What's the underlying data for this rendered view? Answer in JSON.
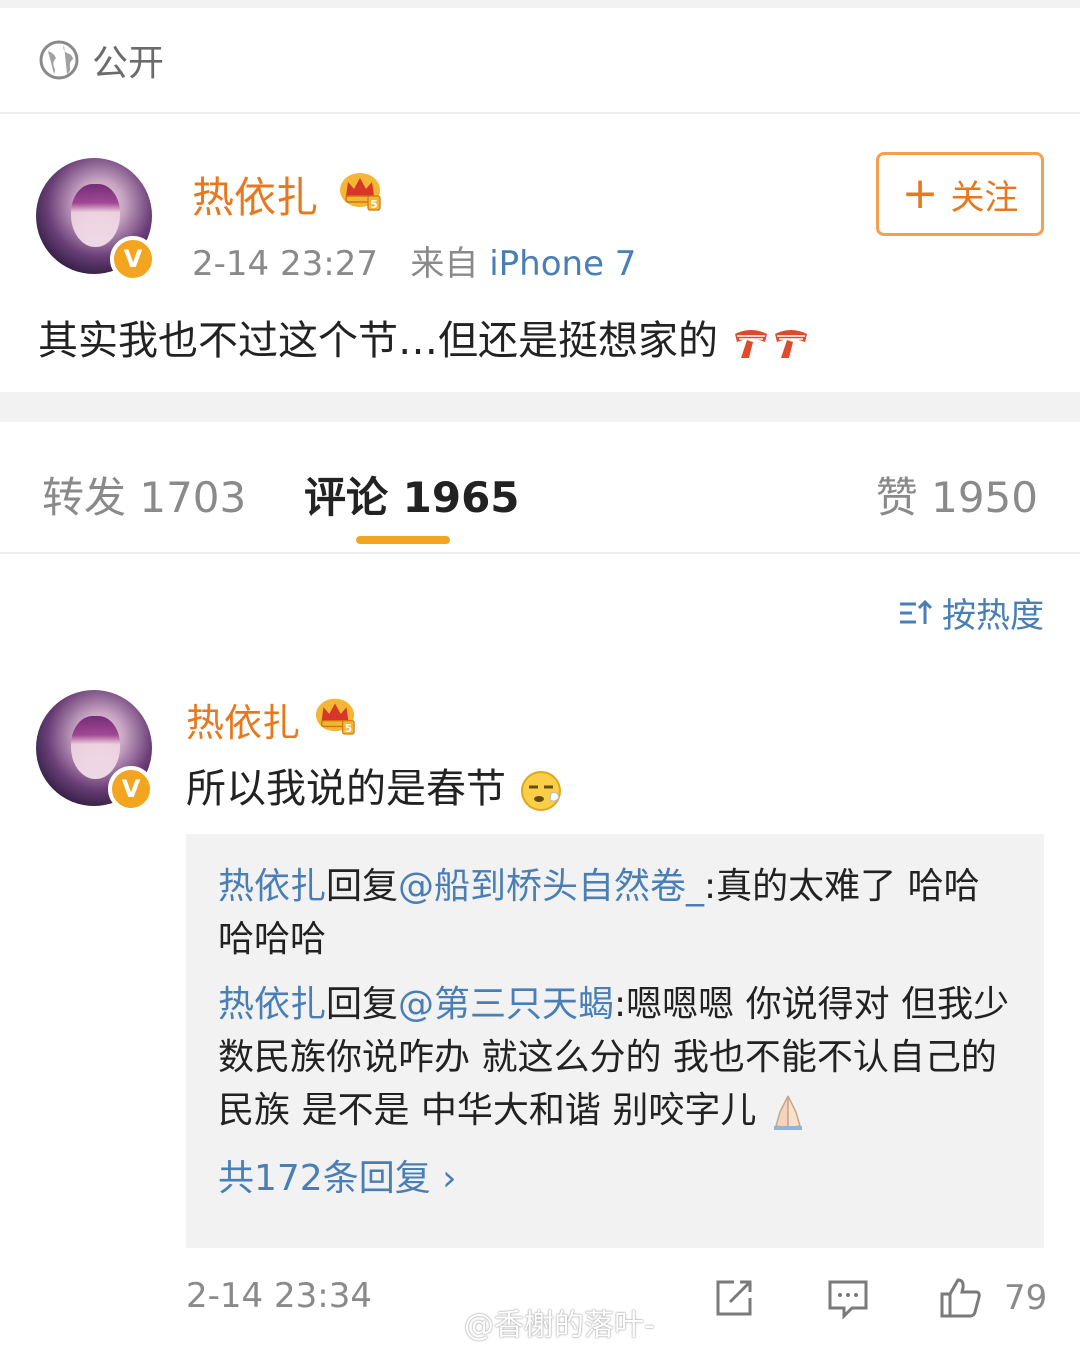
{
  "visibility": {
    "label": "公开",
    "icon": "globe-icon"
  },
  "post": {
    "author": "热依扎",
    "time": "2-14 23:27",
    "source_prefix": "来自",
    "device": "iPhone 7",
    "follow_label": "关注",
    "content": "其实我也不过这个节…但还是挺想家的"
  },
  "tabs": {
    "repost": "转发 1703",
    "comment": "评论 1965",
    "like": "赞 1950"
  },
  "sort_label": "按热度",
  "comment": {
    "author": "热依扎",
    "text": "所以我说的是春节",
    "time": "2-14 23:34",
    "likes": "79",
    "replies": [
      {
        "name": "热依扎",
        "verb": "回复",
        "target": "@船到桥头自然卷_",
        "text": ":真的太难了 哈哈哈哈哈"
      },
      {
        "name": "热依扎",
        "verb": "回复",
        "target": "@第三只天蝎",
        "text": ":嗯嗯嗯 你说得对 但我少数民族你说咋办 就这么分的 我也不能不认自己的民族 是不是 中华大和谐 别咬字儿"
      }
    ],
    "reply_total": "共172条回复 ›"
  },
  "watermark": "@香榭的落叶-",
  "colors": {
    "accent_orange": "#e8781e",
    "link_blue": "#4a7fb5",
    "tab_indicator": "#f3a520",
    "badge": "#f3a520"
  }
}
